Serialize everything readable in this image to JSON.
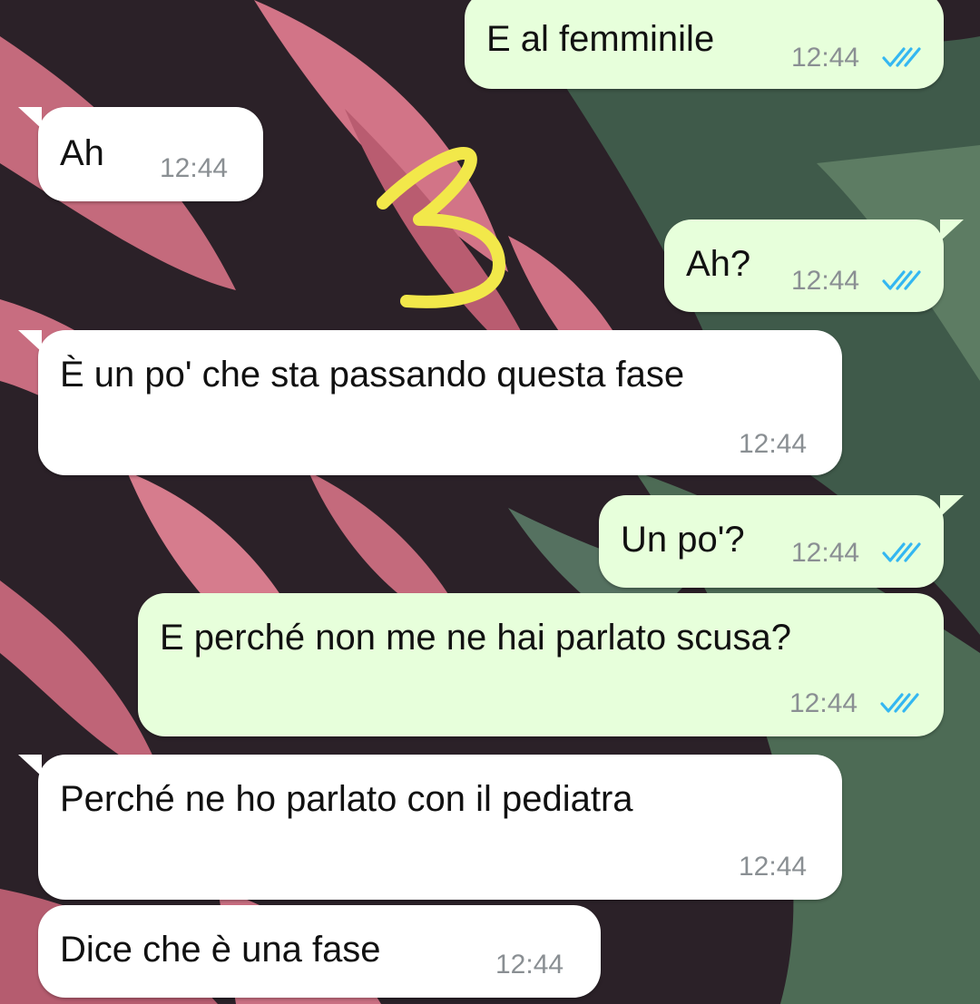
{
  "colors": {
    "outgoing_bubble": "#e7ffdb",
    "incoming_bubble": "#ffffff",
    "read_ticks": "#34b7f1",
    "timestamp": "#8a8f93",
    "annotation": "#f2e84a"
  },
  "annotation": {
    "label": "3"
  },
  "messages": [
    {
      "direction": "out",
      "text": "E al femminile",
      "time": "12:44",
      "status": "read"
    },
    {
      "direction": "in",
      "text": "Ah",
      "time": "12:44"
    },
    {
      "direction": "out",
      "text": "Ah?",
      "time": "12:44",
      "status": "read"
    },
    {
      "direction": "in",
      "text": "È un po' che sta passando questa fase",
      "time": "12:44"
    },
    {
      "direction": "out",
      "text": "Un po'?",
      "time": "12:44",
      "status": "read"
    },
    {
      "direction": "out",
      "text": "E perché non me ne hai parlato scusa?",
      "time": "12:44",
      "status": "read"
    },
    {
      "direction": "in",
      "text": "Perché ne ho parlato con il pediatra",
      "time": "12:44"
    },
    {
      "direction": "in",
      "text": "Dice che è una fase",
      "time": "12:44"
    }
  ]
}
